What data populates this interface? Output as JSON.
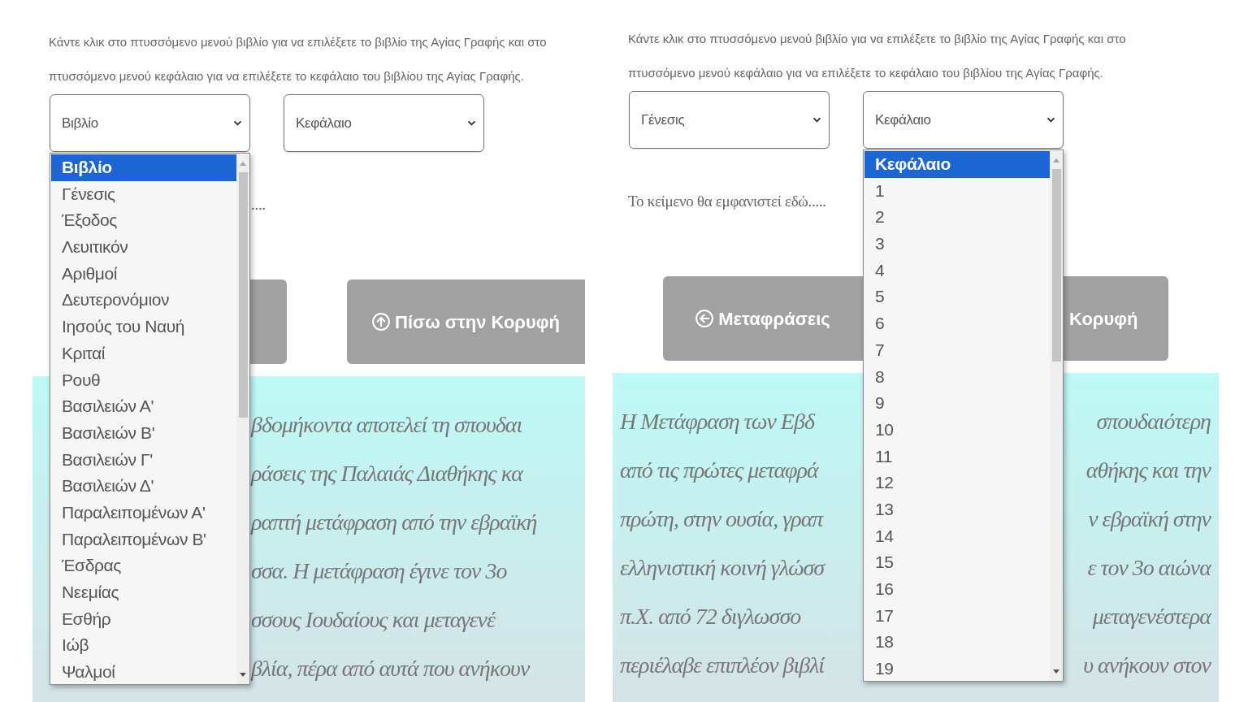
{
  "screens": [
    {
      "instructions": "Κάντε κλικ στο πτυσσόμενο μενού βιβλίο για να επιλέξετε το βιβλίο της Αγίας Γραφής και στο πτυσσόμενο μενού κεφάλαιο για να επιλέξετε το κεφάλαιο του βιβλίου της Αγίας Γραφής.",
      "selects": [
        {
          "value": "Βιβλίο",
          "options": [
            {
              "label": "Βιβλίο",
              "selected": true
            },
            {
              "label": "Γένεσις",
              "selected": false
            },
            {
              "label": "Έξοδος",
              "selected": false
            },
            {
              "label": "Λευιτικόν",
              "selected": false
            },
            {
              "label": "Αριθμοί",
              "selected": false
            },
            {
              "label": "Δευτερονόμιον",
              "selected": false
            },
            {
              "label": "Ιησούς του Ναυή",
              "selected": false
            },
            {
              "label": "Κριταί",
              "selected": false
            },
            {
              "label": "Ρουθ",
              "selected": false
            },
            {
              "label": "Βασιλειών Α'",
              "selected": false
            },
            {
              "label": "Βασιλειών Β'",
              "selected": false
            },
            {
              "label": "Βασιλειών Γ'",
              "selected": false
            },
            {
              "label": "Βασιλειών Δ'",
              "selected": false
            },
            {
              "label": "Παραλειπομένων Α'",
              "selected": false
            },
            {
              "label": "Παραλειπομένων Β'",
              "selected": false
            },
            {
              "label": "Έσδρας",
              "selected": false
            },
            {
              "label": "Νεεμίας",
              "selected": false
            },
            {
              "label": "Εσθήρ",
              "selected": false
            },
            {
              "label": "Ιώβ",
              "selected": false
            },
            {
              "label": "Ψαλμοί",
              "selected": false
            }
          ]
        },
        {
          "value": "Κεφάλαιο"
        }
      ],
      "output_text": "....",
      "buttons": [
        {
          "kind": "covered"
        },
        {
          "kind": "top",
          "label": "Πίσω στην Κορυφή"
        }
      ],
      "passage": {
        "lines": [
          {
            "segments": [
              "βδομήκοντα αποτελεί τη σπουδαι"
            ]
          },
          {
            "segments": [
              "ράσεις της Παλαιάς Διαθήκης κα"
            ]
          },
          {
            "segments": [
              "ραπτή μετάφραση από την εβραϊκή"
            ]
          },
          {
            "segments": [
              "σσα. Η μετάφραση έγινε τον 3ο"
            ]
          },
          {
            "segments": [
              "σσους Ιουδαίους και μεταγενέ"
            ]
          },
          {
            "segments": [
              "βλία, πέρα από αυτά που ανήκουν"
            ]
          }
        ]
      }
    },
    {
      "instructions": "Κάντε κλικ στο πτυσσόμενο μενού βιβλίο για να επιλέξετε το βιβλίο της Αγίας Γραφής και στο πτυσσόμενο μενού κεφάλαιο για να επιλέξετε το κεφάλαιο του βιβλίου της Αγίας Γραφής.",
      "selects": [
        {
          "value": "Γένεσις"
        },
        {
          "value": "Κεφάλαιο",
          "options": [
            {
              "label": "Κεφάλαιο",
              "selected": true
            },
            {
              "label": "1",
              "selected": false
            },
            {
              "label": "2",
              "selected": false
            },
            {
              "label": "3",
              "selected": false
            },
            {
              "label": "4",
              "selected": false
            },
            {
              "label": "5",
              "selected": false
            },
            {
              "label": "6",
              "selected": false
            },
            {
              "label": "7",
              "selected": false
            },
            {
              "label": "8",
              "selected": false
            },
            {
              "label": "9",
              "selected": false
            },
            {
              "label": "10",
              "selected": false
            },
            {
              "label": "11",
              "selected": false
            },
            {
              "label": "12",
              "selected": false
            },
            {
              "label": "13",
              "selected": false
            },
            {
              "label": "14",
              "selected": false
            },
            {
              "label": "15",
              "selected": false
            },
            {
              "label": "16",
              "selected": false
            },
            {
              "label": "17",
              "selected": false
            },
            {
              "label": "18",
              "selected": false
            },
            {
              "label": "19",
              "selected": false
            }
          ]
        }
      ],
      "output_text": "Το κείμενο θα εμφανιστεί εδώ.....",
      "buttons": [
        {
          "kind": "back",
          "label": "Μεταφράσεις"
        },
        {
          "kind": "plain",
          "label": "Κορυφή"
        }
      ],
      "passage": {
        "lines": [
          {
            "segments": [
              "Η Μετάφραση των Εβδ",
              "σπουδαιότερη"
            ]
          },
          {
            "segments": [
              "από τις πρώτες μεταφρά",
              "αθήκης και την"
            ]
          },
          {
            "segments": [
              "πρώτη, στην ουσία, γραπ",
              "ν εβραϊκή στην"
            ]
          },
          {
            "segments": [
              "ελληνιστική κοινή γλώσσ",
              "ε τον 3ο αιώνα"
            ]
          },
          {
            "segments": [
              "π.Χ. από 72 διγλωσσο",
              "μεταγενέστερα"
            ]
          },
          {
            "segments": [
              "περιέλαβε επιπλέον βιβλί",
              "υ ανήκουν στον"
            ]
          }
        ]
      }
    }
  ]
}
